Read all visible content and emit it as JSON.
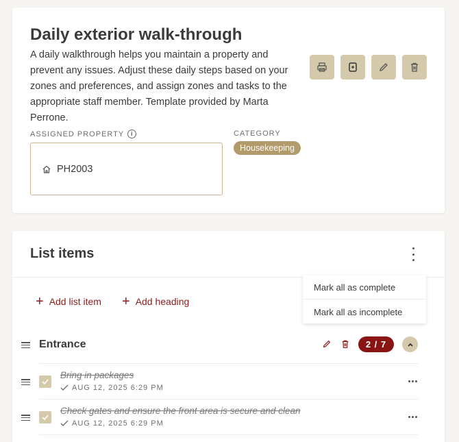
{
  "template": {
    "title": "Daily exterior walk-through",
    "description": "A daily walkthrough helps you maintain a property and prevent any issues. Adjust these daily steps based on your zones and preferences, and assign zones and tasks to the appropriate staff member. Template provided by Marta Perrone.",
    "actions": [
      {
        "icon": "print-icon"
      },
      {
        "icon": "copy-icon"
      },
      {
        "icon": "edit-icon"
      },
      {
        "icon": "trash-icon"
      }
    ],
    "assigned_property_label": "ASSIGNED PROPERTY",
    "assigned_property_info_icon": "info-icon",
    "assigned_property_value": "PH2003",
    "assigned_property_icon": "home-icon",
    "category_label": "CATEGORY",
    "category_value": "Housekeeping"
  },
  "list": {
    "title": "List items",
    "add_item_label": "Add list item",
    "add_heading_label": "Add heading",
    "menu": {
      "mark_complete": "Mark all as complete",
      "mark_incomplete": "Mark all as incomplete"
    },
    "sections": [
      {
        "title": "Entrance",
        "count": "2 / 7",
        "items": [
          {
            "text": "Bring in packages",
            "meta": "AUG 12, 2025 6:29 PM",
            "checked": true
          },
          {
            "text": "Check gates and ensure the front area is secure and clean",
            "meta": "AUG 12, 2025 6:29 PM",
            "checked": true
          }
        ]
      }
    ]
  },
  "colors": {
    "accent_brown": "#d5c9ac",
    "badge_brown": "#b39a6a",
    "link_red": "#8a1c1c",
    "count_red": "#8a1414",
    "background": "#f6f5f1"
  }
}
